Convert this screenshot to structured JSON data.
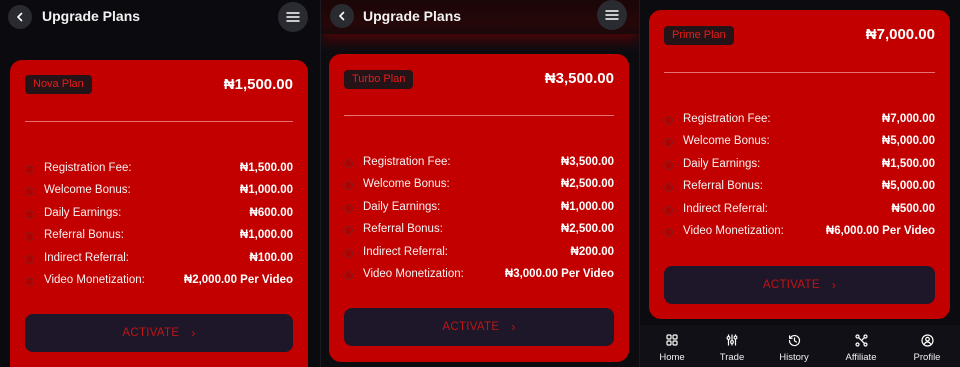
{
  "header": {
    "title": "Upgrade Plans",
    "back_icon": "chevron-left-icon",
    "menu_icon": "hamburger-menu-icon"
  },
  "colors": {
    "card": "#c20000",
    "background": "#0b0b0f",
    "button": "#1e1729",
    "badge": "#241418",
    "accent_text": "#e81c1c"
  },
  "plans": [
    {
      "name": "Nova Plan",
      "price": "₦1,500.00",
      "rows": [
        {
          "label": "Registration Fee:",
          "value": "₦1,500.00"
        },
        {
          "label": "Welcome Bonus:",
          "value": "₦1,000.00"
        },
        {
          "label": "Daily Earnings:",
          "value": "₦600.00"
        },
        {
          "label": "Referral Bonus:",
          "value": "₦1,000.00"
        },
        {
          "label": "Indirect Referral:",
          "value": "₦100.00"
        },
        {
          "label": "Video Monetization:",
          "value": "₦2,000.00 Per Video"
        }
      ],
      "button": "ACTIVATE"
    },
    {
      "name": "Turbo Plan",
      "price": "₦3,500.00",
      "rows": [
        {
          "label": "Registration Fee:",
          "value": "₦3,500.00"
        },
        {
          "label": "Welcome Bonus:",
          "value": "₦2,500.00"
        },
        {
          "label": "Daily Earnings:",
          "value": "₦1,000.00"
        },
        {
          "label": "Referral Bonus:",
          "value": "₦2,500.00"
        },
        {
          "label": "Indirect Referral:",
          "value": "₦200.00"
        },
        {
          "label": "Video Monetization:",
          "value": "₦3,000.00 Per Video"
        }
      ],
      "button": "ACTIVATE"
    },
    {
      "name": "Prime Plan",
      "price": "₦7,000.00",
      "rows": [
        {
          "label": "Registration Fee:",
          "value": "₦7,000.00"
        },
        {
          "label": "Welcome Bonus:",
          "value": "₦5,000.00"
        },
        {
          "label": "Daily Earnings:",
          "value": "₦1,500.00"
        },
        {
          "label": "Referral Bonus:",
          "value": "₦5,000.00"
        },
        {
          "label": "Indirect Referral:",
          "value": "₦500.00"
        },
        {
          "label": "Video Monetization:",
          "value": "₦6,000.00 Per Video"
        }
      ],
      "button": "ACTIVATE"
    }
  ],
  "bottom_nav": [
    {
      "label": "Home",
      "icon": "grid-icon"
    },
    {
      "label": "Trade",
      "icon": "sliders-icon"
    },
    {
      "label": "History",
      "icon": "history-icon"
    },
    {
      "label": "Affiliate",
      "icon": "share-nodes-icon"
    },
    {
      "label": "Profile",
      "icon": "user-circle-icon"
    }
  ]
}
